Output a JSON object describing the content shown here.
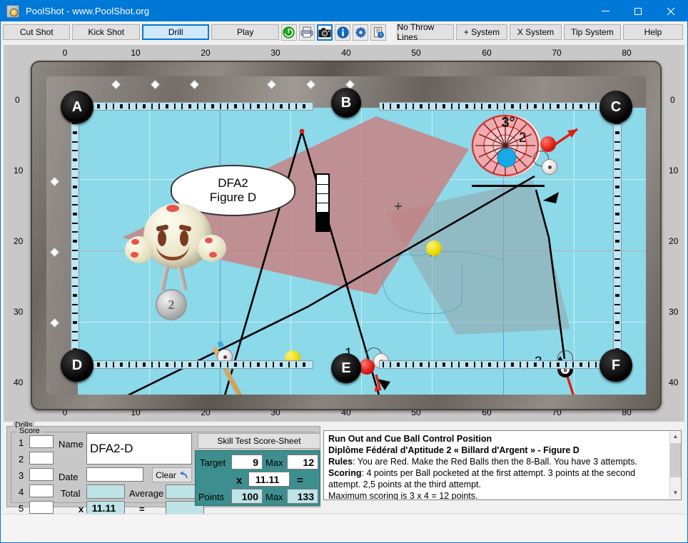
{
  "window": {
    "title": "PoolShot - www.PoolShot.org",
    "icon": "poolshot-logo-icon",
    "minimize": "minimize-icon",
    "maximize": "maximize-icon",
    "close": "close-icon"
  },
  "toolbar": {
    "mode_buttons": [
      {
        "label": "Cut Shot",
        "selected": false
      },
      {
        "label": "Kick Shot",
        "selected": false
      },
      {
        "label": "Drill",
        "selected": true
      },
      {
        "label": "Play",
        "selected": false
      }
    ],
    "icon_buttons": [
      {
        "name": "power-icon",
        "selected": false
      },
      {
        "name": "printer-icon",
        "selected": false
      },
      {
        "name": "camera-icon",
        "selected": true
      },
      {
        "name": "info-icon",
        "selected": false
      },
      {
        "name": "gear-icon",
        "selected": false
      },
      {
        "name": "help-document-icon",
        "selected": false
      }
    ],
    "system_buttons": [
      {
        "label": "No Throw Lines"
      },
      {
        "label": "+ System"
      },
      {
        "label": "X System"
      },
      {
        "label": "Tip System"
      }
    ],
    "help_label": "Help"
  },
  "table": {
    "ruler_top": [
      "0",
      "10",
      "20",
      "30",
      "40",
      "50",
      "60",
      "70",
      "80"
    ],
    "ruler_bottom": [
      "0",
      "10",
      "20",
      "30",
      "40",
      "50",
      "60",
      "70",
      "80"
    ],
    "ruler_left": [
      "0",
      "10",
      "20",
      "30",
      "40"
    ],
    "ruler_right": [
      "0",
      "10",
      "20",
      "30",
      "40"
    ],
    "pockets": [
      "A",
      "B",
      "C",
      "D",
      "E",
      "F"
    ],
    "ball_labels": [
      "1",
      "2",
      "3"
    ],
    "spin_indicator": {
      "angle_label": "3°"
    },
    "bubble": {
      "line1": "DFA2",
      "line2": "Figure D"
    },
    "medal": {
      "rank": "2"
    }
  },
  "drills": {
    "group_label": "Drills",
    "score_group_label": "Score",
    "rows": [
      "1",
      "2",
      "3",
      "4",
      "5"
    ],
    "row_values": [
      "",
      "",
      "",
      "",
      ""
    ],
    "name_label": "Name",
    "name_value": "DFA2-D",
    "date_label": "Date",
    "date_value": "",
    "clear_label": "Clear",
    "clear_icon": "undo-arrow-icon",
    "total_label": "Total",
    "total_value": "",
    "average_label": "Average",
    "average_value": "",
    "multiply_label": "x",
    "multiplier_value": "11.11",
    "equals_label": "=",
    "result_value": ""
  },
  "scoresheet": {
    "header": "Skill Test Score-Sheet",
    "target_label": "Target",
    "target_value": "9",
    "target_max_label": "Max",
    "target_max_value": "12",
    "multiply_label": "x",
    "factor_value": "11.11",
    "equals_label": "=",
    "points_label": "Points",
    "points_value": "100",
    "points_max_label": "Max",
    "points_max_value": "133"
  },
  "description": {
    "title": "Run Out and Cue Ball Control Position",
    "subtitle": "Diplôme Fédéral d'Aptitude 2 « Billard d'Argent » - Figure D",
    "rules_label": "Rules",
    "rules_text": ": You are Red. Make the Red Balls then the 8-Ball. You have 3 attempts.",
    "scoring_label": "Scoring",
    "scoring_text": ": 4 points per Ball pocketed at the first attempt. 3 points at the second attempt. 2,5 points at the third attempt.",
    "max_text": "Maximum scoring is 3 x 4 = 12 points.",
    "scroll_up": "scroll-up-icon",
    "scroll_down": "scroll-down-icon"
  },
  "colors": {
    "accent": "#0078d7",
    "felt": "#8cd9ea",
    "teal_panel": "#3d8e8e",
    "cyan_field": "#bfe4e8",
    "ball_red": "#e11a14",
    "ball_yellow": "#e8d800",
    "shot_cone": "#cc7a7a",
    "ghost_cone": "#93a8ad"
  }
}
